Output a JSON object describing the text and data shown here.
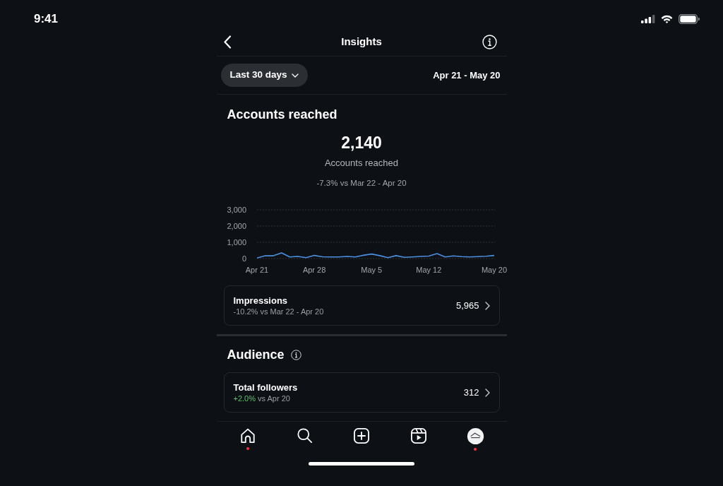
{
  "status_bar": {
    "time": "9:41"
  },
  "header": {
    "title": "Insights"
  },
  "filter": {
    "period": "Last 30 days",
    "date_range": "Apr 21 - May 20"
  },
  "accounts_reached": {
    "title": "Accounts reached",
    "total": "2,140",
    "total_label": "Accounts reached",
    "change": "-7.3% vs Mar 22 - Apr 20",
    "chart_data": {
      "type": "line",
      "categories": [
        "Apr 21",
        null,
        null,
        null,
        null,
        null,
        null,
        "Apr 28",
        null,
        null,
        null,
        null,
        null,
        null,
        "May 5",
        null,
        null,
        null,
        null,
        null,
        null,
        "May 12",
        null,
        null,
        null,
        null,
        null,
        null,
        null,
        "May 20"
      ],
      "ylim": [
        0,
        3000
      ],
      "yticks": [
        {
          "value": 0,
          "label": "0"
        },
        {
          "value": 1000,
          "label": "1,000"
        },
        {
          "value": 2000,
          "label": "2,000"
        },
        {
          "value": 3000,
          "label": "3,000"
        }
      ],
      "series": [
        {
          "color": "#4a8fe0",
          "values": [
            30,
            170,
            170,
            350,
            100,
            130,
            50,
            190,
            110,
            100,
            100,
            130,
            100,
            200,
            280,
            180,
            50,
            180,
            80,
            100,
            130,
            150,
            300,
            100,
            160,
            120,
            100,
            120,
            140,
            190
          ]
        }
      ]
    },
    "metrics": [
      {
        "label": "Impressions",
        "delta": "-10.2%",
        "color": "#9c9fa4",
        "comparison": "vs Mar 22 - Apr 20",
        "value": "5,965"
      }
    ]
  },
  "audience": {
    "title": "Audience",
    "metrics": [
      {
        "label": "Total followers",
        "delta": "+2.0%",
        "color": "#5cc46b",
        "comparison": "vs Apr 20",
        "value": "312"
      }
    ]
  },
  "nav": {
    "items": [
      {
        "badge": true
      },
      {
        "badge": false
      },
      {
        "badge": false
      },
      {
        "badge": false
      },
      {
        "badge": true
      }
    ]
  }
}
